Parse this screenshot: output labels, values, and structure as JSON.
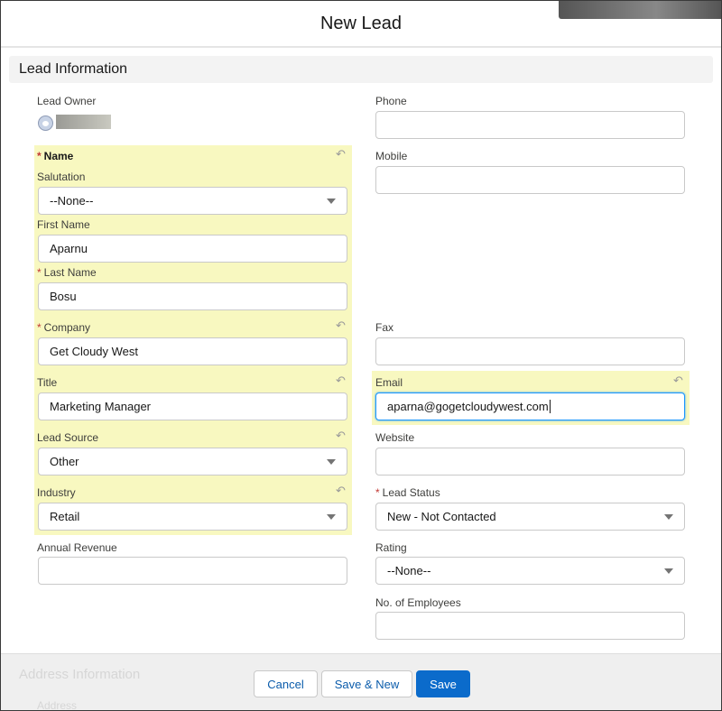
{
  "modal": {
    "title": "New Lead",
    "section_title": "Lead Information"
  },
  "left": {
    "lead_owner": {
      "label": "Lead Owner",
      "icon": "user-avatar-icon"
    },
    "name_group": {
      "label": "Name",
      "required": "*"
    },
    "salutation": {
      "label": "Salutation",
      "value": "--None--"
    },
    "first_name": {
      "label": "First Name",
      "value": "Aparnu"
    },
    "last_name": {
      "label": "Last Name",
      "value": "Bosu",
      "required": "*"
    },
    "company": {
      "label": "Company",
      "value": "Get Cloudy West",
      "required": "*"
    },
    "title": {
      "label": "Title",
      "value": "Marketing Manager"
    },
    "lead_source": {
      "label": "Lead Source",
      "value": "Other"
    },
    "industry": {
      "label": "Industry",
      "value": "Retail"
    },
    "annual_revenue": {
      "label": "Annual Revenue",
      "value": ""
    }
  },
  "right": {
    "phone": {
      "label": "Phone",
      "value": ""
    },
    "mobile": {
      "label": "Mobile",
      "value": ""
    },
    "fax": {
      "label": "Fax",
      "value": ""
    },
    "email": {
      "label": "Email",
      "value": "aparna@gogetcloudywest.com"
    },
    "website": {
      "label": "Website",
      "value": ""
    },
    "lead_status": {
      "label": "Lead Status",
      "value": "New - Not Contacted",
      "required": "*"
    },
    "rating": {
      "label": "Rating",
      "value": "--None--"
    },
    "employees": {
      "label": "No. of Employees",
      "value": ""
    }
  },
  "footer": {
    "next_section": "Address Information",
    "next_field": "Address",
    "cancel": "Cancel",
    "save_new": "Save & New",
    "save": "Save"
  },
  "undo_glyph": "↶"
}
